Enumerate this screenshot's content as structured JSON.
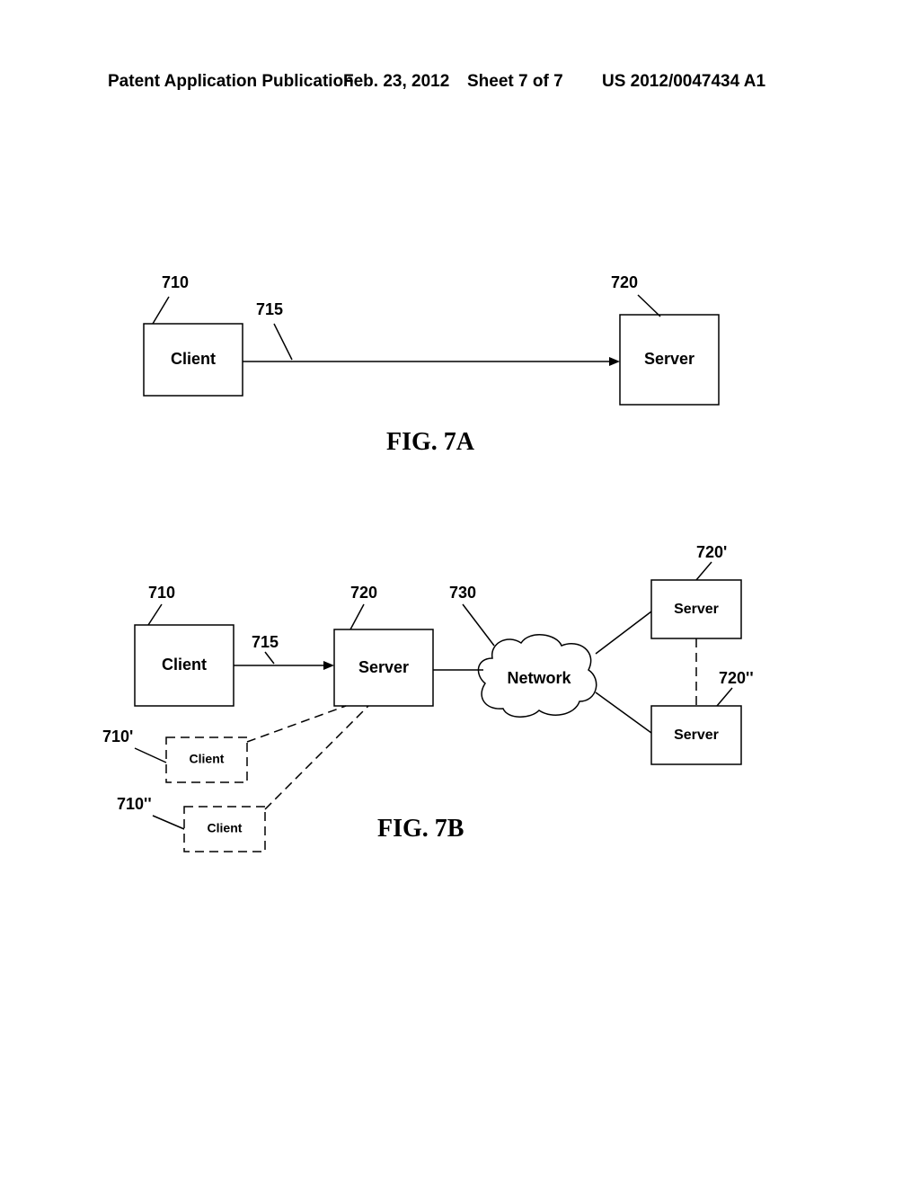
{
  "header": {
    "left": "Patent Application Publication",
    "date": "Feb. 23, 2012",
    "sheet": "Sheet 7 of 7",
    "pub": "US 2012/0047434 A1"
  },
  "figA": {
    "title": "FIG. 7A",
    "client": {
      "ref": "710",
      "label": "Client"
    },
    "link": {
      "ref": "715"
    },
    "server": {
      "ref": "720",
      "label": "Server"
    }
  },
  "figB": {
    "title": "FIG. 7B",
    "client": {
      "ref": "710",
      "label": "Client"
    },
    "client2": {
      "ref": "710'",
      "label": "Client"
    },
    "client3": {
      "ref": "710''",
      "label": "Client"
    },
    "link": {
      "ref": "715"
    },
    "server": {
      "ref": "720",
      "label": "Server"
    },
    "server2": {
      "ref": "720'",
      "label": "Server"
    },
    "server3": {
      "ref": "720''",
      "label": "Server"
    },
    "network": {
      "ref": "730",
      "label": "Network"
    }
  }
}
